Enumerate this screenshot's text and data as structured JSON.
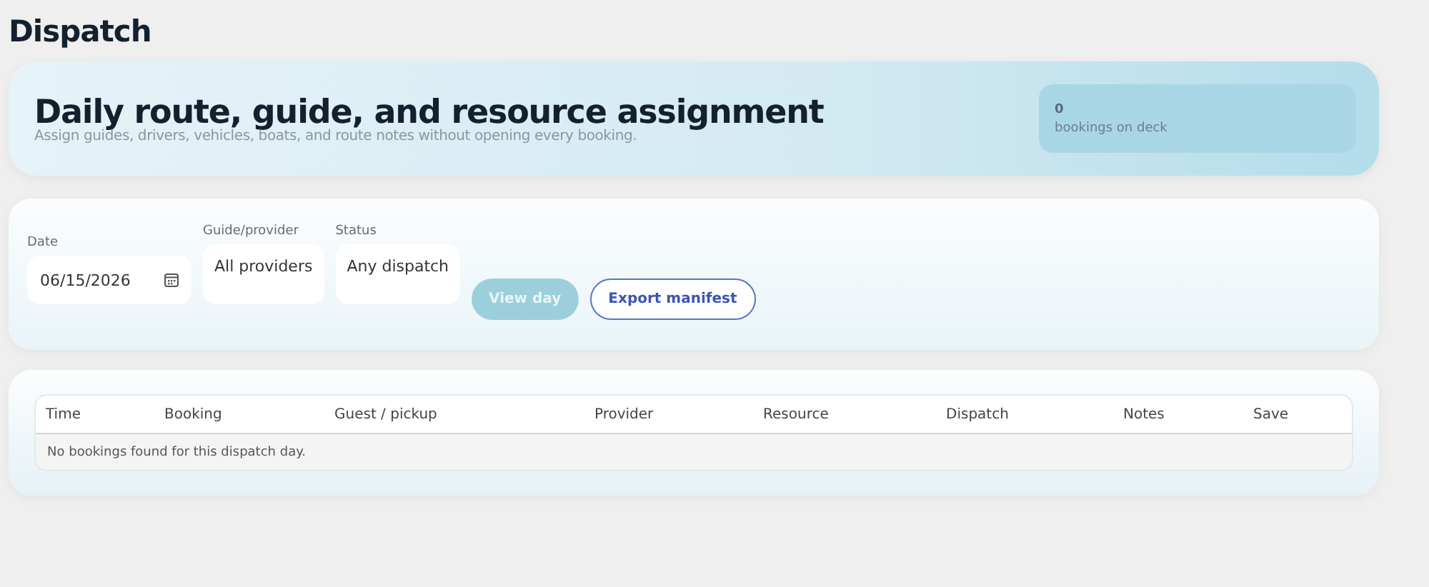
{
  "page": {
    "title": "Dispatch"
  },
  "hero": {
    "heading": "Daily route, guide, and resource assignment",
    "subtitle": "Assign guides, drivers, vehicles, boats, and route notes without opening every booking.",
    "stat": {
      "value": "0",
      "label": "bookings on deck"
    }
  },
  "filters": [
    {
      "kind": "date",
      "label": "Date",
      "value": "06/15/2026"
    },
    {
      "kind": "select",
      "label": "Guide/provider",
      "value": "All providers"
    },
    {
      "kind": "select",
      "label": "Status",
      "value": "Any dispatch"
    }
  ],
  "buttons": [
    {
      "label": "View day",
      "kind": "primary",
      "disabled": true
    },
    {
      "label": "Export manifest",
      "kind": "outline",
      "disabled": false
    }
  ],
  "table": {
    "columns": [
      "Time",
      "Booking",
      "Guest / pickup",
      "Provider",
      "Resource",
      "Dispatch",
      "Notes",
      "Save"
    ],
    "empty_message": "No bookings found for this dispatch day."
  }
}
